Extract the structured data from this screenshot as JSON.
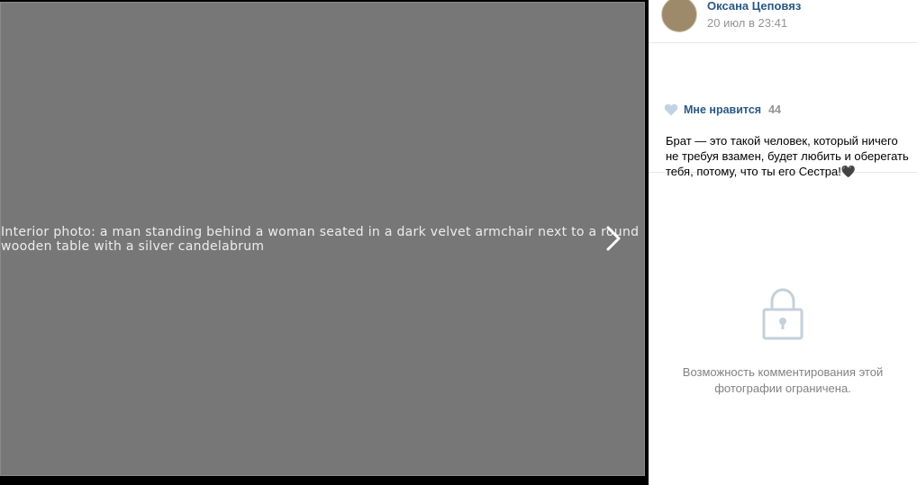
{
  "photo": {
    "alt": "Interior photo: a man standing behind a woman seated in a dark velvet armchair next to a round wooden table with a silver candelabrum"
  },
  "viewer": {
    "next_icon": "chevron-right-icon"
  },
  "author": {
    "name": "Оксана Цеповяз",
    "date": "20 июл в 23:41",
    "avatar_icon": "avatar"
  },
  "likes": {
    "label": "Мне нравится",
    "count": "44",
    "icon": "heart-icon"
  },
  "description": "Брат — это такой человек, который ничего не требуя взамен, будет любить и оберегать тебя, потому, что ты его Сестра!🖤",
  "comments": {
    "restricted_text": "Возможность комментирования этой фотографии ограничена.",
    "icon": "lock-icon"
  },
  "colors": {
    "link": "#2a5885",
    "muted": "#939393",
    "heart": "#c3d2e2",
    "lock": "#c5d0db"
  }
}
